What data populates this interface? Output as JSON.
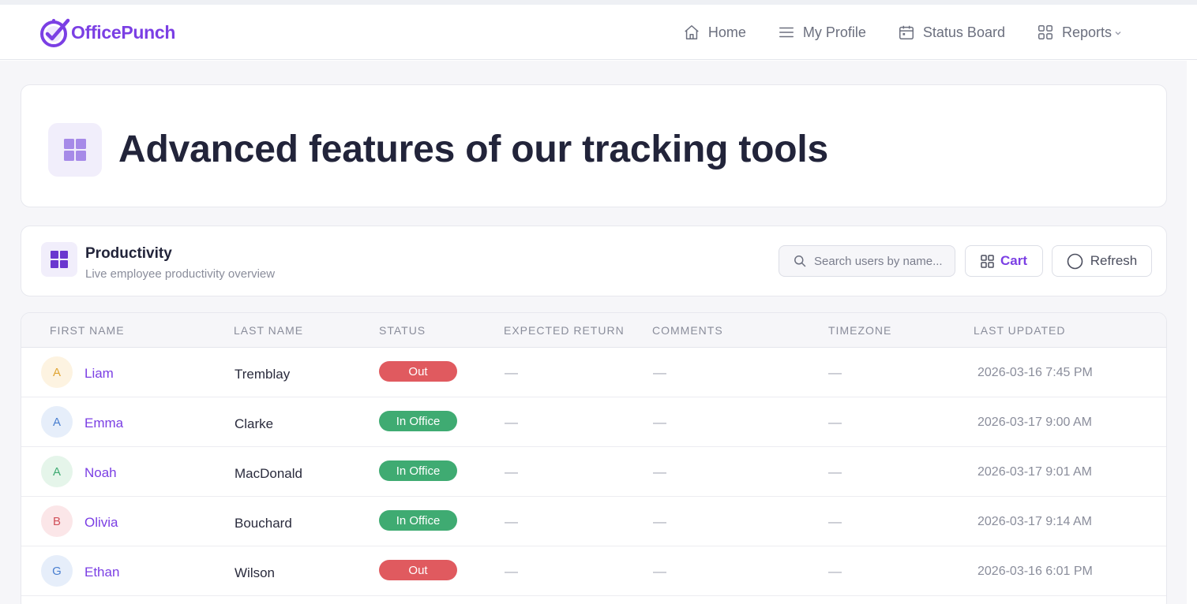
{
  "app": {
    "brand": "OfficePunch",
    "colors": {
      "accent": "#7b3fe4",
      "status_out": "#e05a5f",
      "status_in_office": "#3fab72"
    }
  },
  "nav": {
    "items": [
      {
        "label": "Home",
        "icon": "home-icon"
      },
      {
        "label": "My Profile",
        "icon": "menu-lines-icon"
      },
      {
        "label": "Status Board",
        "icon": "calendar-icon"
      },
      {
        "label": "Reports",
        "icon": "grid-icon",
        "has_dropdown": true
      }
    ]
  },
  "hero": {
    "title": "Advanced features of our tracking tools",
    "icon": "grid-icon"
  },
  "panel": {
    "title": "Productivity",
    "subtitle": "Live employee productivity overview",
    "icon": "grid-icon",
    "search_placeholder": "Search users by name...",
    "cart_label": "Cart",
    "refresh_label": "Refresh"
  },
  "table": {
    "columns": [
      "FIRST NAME",
      "LAST NAME",
      "STATUS",
      "EXPECTED RETURN",
      "COMMENTS",
      "TIMEZONE",
      "LAST UPDATED"
    ],
    "rows": [
      {
        "initial": "A",
        "first": "Liam",
        "last": "Tremblay",
        "status": "Out",
        "expected_return": "—",
        "comments": "—",
        "timezone": "—",
        "updated": "2026-03-16 7:45 PM",
        "avatar_bg": "#fdf3e1",
        "avatar_fg": "#e0a534"
      },
      {
        "initial": "A",
        "first": "Emma",
        "last": "Clarke",
        "status": "In Office",
        "expected_return": "—",
        "comments": "—",
        "timezone": "—",
        "updated": "2026-03-17 9:00 AM",
        "avatar_bg": "#e6eefa",
        "avatar_fg": "#4a7fd0"
      },
      {
        "initial": "A",
        "first": "Noah",
        "last": "MacDonald",
        "status": "In Office",
        "expected_return": "—",
        "comments": "—",
        "timezone": "—",
        "updated": "2026-03-17 9:01 AM",
        "avatar_bg": "#e5f5ea",
        "avatar_fg": "#3fab72"
      },
      {
        "initial": "B",
        "first": "Olivia",
        "last": "Bouchard",
        "status": "In Office",
        "expected_return": "—",
        "comments": "—",
        "timezone": "—",
        "updated": "2026-03-17 9:14 AM",
        "avatar_bg": "#fbe6e8",
        "avatar_fg": "#d1505a"
      },
      {
        "initial": "G",
        "first": "Ethan",
        "last": "Wilson",
        "status": "Out",
        "expected_return": "—",
        "comments": "—",
        "timezone": "—",
        "updated": "2026-03-16 6:01 PM",
        "avatar_bg": "#e6eefa",
        "avatar_fg": "#4a7fd0"
      }
    ]
  }
}
